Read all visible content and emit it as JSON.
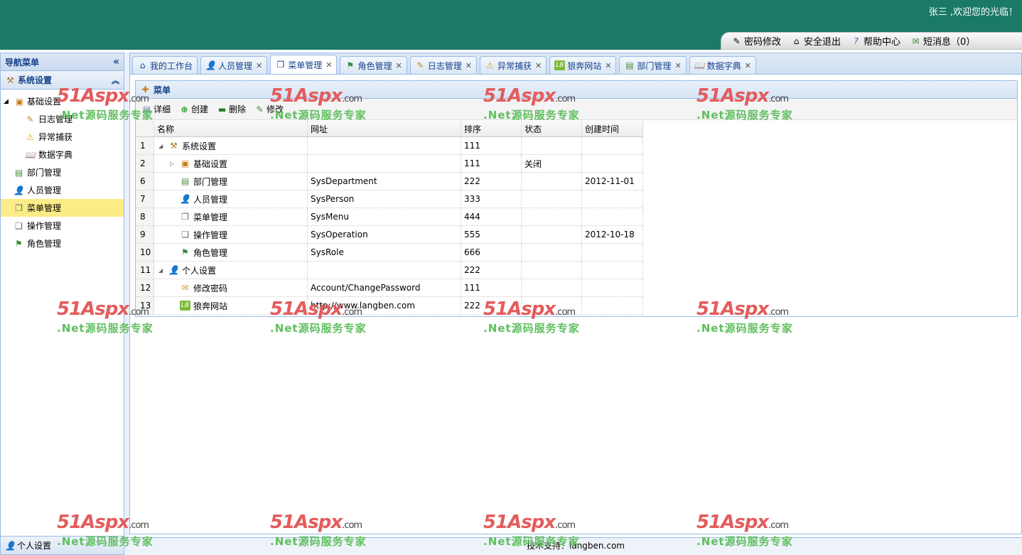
{
  "header": {
    "welcome": "张三 ,欢迎您的光临！",
    "links": [
      {
        "label": "密码修改",
        "icon": "key-pencil-icon"
      },
      {
        "label": "安全退出",
        "icon": "exit-icon"
      },
      {
        "label": "帮助中心",
        "icon": "help-icon"
      },
      {
        "label": "短消息（0）",
        "icon": "message-icon"
      }
    ]
  },
  "sidebar": {
    "title": "导航菜单",
    "section": "系统设置",
    "tree": [
      {
        "label": "基础设置",
        "icon": "book-icon",
        "level": 0,
        "expanded": true
      },
      {
        "label": "日志管理",
        "icon": "log-icon",
        "level": 1
      },
      {
        "label": "异常捕获",
        "icon": "warning-icon",
        "level": 1
      },
      {
        "label": "数据字典",
        "icon": "open-book-icon",
        "level": 1
      },
      {
        "label": "部门管理",
        "icon": "department-icon",
        "level": 0
      },
      {
        "label": "人员管理",
        "icon": "person-icon",
        "level": 0
      },
      {
        "label": "菜单管理",
        "icon": "menu-icon",
        "level": 0,
        "selected": true
      },
      {
        "label": "操作管理",
        "icon": "operation-icon",
        "level": 0
      },
      {
        "label": "角色管理",
        "icon": "role-icon",
        "level": 0
      }
    ],
    "footer_section": "个人设置"
  },
  "tabs": [
    {
      "label": "我的工作台",
      "icon": "home-icon",
      "closable": false
    },
    {
      "label": "人员管理",
      "icon": "person-icon",
      "closable": true
    },
    {
      "label": "菜单管理",
      "icon": "menu-icon",
      "closable": true,
      "active": true
    },
    {
      "label": "角色管理",
      "icon": "role-icon",
      "closable": true
    },
    {
      "label": "日志管理",
      "icon": "log-icon",
      "closable": true
    },
    {
      "label": "异常捕获",
      "icon": "warning-icon",
      "closable": true
    },
    {
      "label": "狼奔网站",
      "icon": "lb-icon",
      "closable": true
    },
    {
      "label": "部门管理",
      "icon": "department-icon",
      "closable": true
    },
    {
      "label": "数据字典",
      "icon": "open-book-icon",
      "closable": true
    }
  ],
  "panel": {
    "title": "菜单",
    "toolbar": [
      "详细",
      "创建",
      "删除",
      "修改"
    ],
    "columns": [
      "名称",
      "网址",
      "排序",
      "状态",
      "创建时间"
    ],
    "rows": [
      {
        "num": "1",
        "name": "系统设置",
        "url": "",
        "sort": "111",
        "status": "",
        "date": "",
        "indent": 0,
        "toggle": "expanded",
        "icon": "tools-icon"
      },
      {
        "num": "2",
        "name": "基础设置",
        "url": "",
        "sort": "111",
        "status": "关闭",
        "date": "",
        "indent": 1,
        "toggle": "collapsed",
        "icon": "book-icon"
      },
      {
        "num": "6",
        "name": "部门管理",
        "url": "SysDepartment",
        "sort": "222",
        "status": "",
        "date": "2012-11-01",
        "indent": 1,
        "toggle": "none",
        "icon": "department-icon"
      },
      {
        "num": "7",
        "name": "人员管理",
        "url": "SysPerson",
        "sort": "333",
        "status": "",
        "date": "",
        "indent": 1,
        "toggle": "none",
        "icon": "person-icon"
      },
      {
        "num": "8",
        "name": "菜单管理",
        "url": "SysMenu",
        "sort": "444",
        "status": "",
        "date": "",
        "indent": 1,
        "toggle": "none",
        "icon": "menu-icon"
      },
      {
        "num": "9",
        "name": "操作管理",
        "url": "SysOperation",
        "sort": "555",
        "status": "",
        "date": "2012-10-18",
        "indent": 1,
        "toggle": "none",
        "icon": "operation-icon"
      },
      {
        "num": "10",
        "name": "角色管理",
        "url": "SysRole",
        "sort": "666",
        "status": "",
        "date": "",
        "indent": 1,
        "toggle": "none",
        "icon": "role-icon"
      },
      {
        "num": "11",
        "name": "个人设置",
        "url": "",
        "sort": "222",
        "status": "",
        "date": "",
        "indent": 0,
        "toggle": "expanded",
        "icon": "person-icon"
      },
      {
        "num": "12",
        "name": "修改密码",
        "url": "Account/ChangePassword",
        "sort": "111",
        "status": "",
        "date": "",
        "indent": 1,
        "toggle": "none",
        "icon": "mail-icon"
      },
      {
        "num": "13",
        "name": "狼奔网站",
        "url": "http://www.langben.com",
        "sort": "222",
        "status": "",
        "date": "",
        "indent": 1,
        "toggle": "none",
        "icon": "lb-icon"
      }
    ]
  },
  "footer": "技术支持：langben.com",
  "watermark": {
    "logo": "51Aspx",
    "domain": ".com",
    "slogan": ".Net源码服务专家"
  },
  "colors": {
    "header_bg": "#1a7a65",
    "border": "#99bbe8",
    "selected": "#fbec88",
    "accent_text": "#15428b"
  }
}
